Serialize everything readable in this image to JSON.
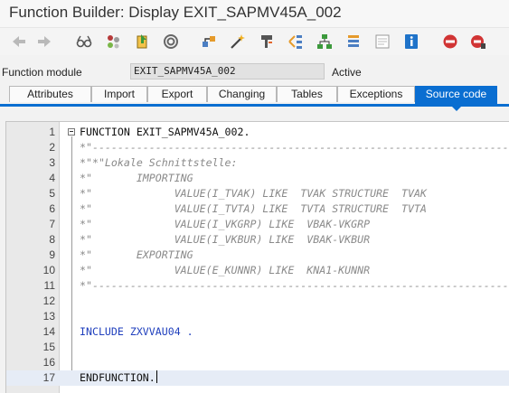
{
  "window": {
    "title": "Function Builder: Display EXIT_SAPMV45A_002"
  },
  "toolbar": {
    "buttons": [
      {
        "icon": "back-arrow-icon"
      },
      {
        "icon": "forward-arrow-icon"
      },
      {
        "icon": "glasses-icon"
      },
      {
        "icon": "other-object-icon"
      },
      {
        "icon": "display-change-icon"
      },
      {
        "icon": "activate-icon"
      },
      {
        "icon": "where-used-icon"
      },
      {
        "icon": "magic-wand-icon"
      },
      {
        "icon": "pretty-printer-icon"
      },
      {
        "icon": "object-list-icon"
      },
      {
        "icon": "hierarchy-icon"
      },
      {
        "icon": "stack-icon"
      },
      {
        "icon": "documentation-icon"
      },
      {
        "icon": "info-icon"
      },
      {
        "icon": "stop-icon"
      },
      {
        "icon": "breakpoint-icon"
      }
    ]
  },
  "header": {
    "label": "Function module",
    "value": "EXIT_SAPMV45A_002",
    "status": "Active"
  },
  "tabs": [
    {
      "label": "Attributes"
    },
    {
      "label": "Import"
    },
    {
      "label": "Export"
    },
    {
      "label": "Changing"
    },
    {
      "label": "Tables"
    },
    {
      "label": "Exceptions"
    },
    {
      "label": "Source code",
      "active": true
    }
  ],
  "editor": {
    "lines": [
      {
        "n": "1",
        "text": "FUNCTION EXIT_SAPMV45A_002.",
        "kind": "code"
      },
      {
        "n": "2",
        "text": "*\"----------------------------------------------------------------------",
        "kind": "comment"
      },
      {
        "n": "3",
        "text": "*\"*\"Lokale Schnittstelle:",
        "kind": "comment"
      },
      {
        "n": "4",
        "text": "*\"       IMPORTING",
        "kind": "comment"
      },
      {
        "n": "5",
        "text": "*\"             VALUE(I_TVAK) LIKE  TVAK STRUCTURE  TVAK",
        "kind": "comment"
      },
      {
        "n": "6",
        "text": "*\"             VALUE(I_TVTA) LIKE  TVTA STRUCTURE  TVTA",
        "kind": "comment"
      },
      {
        "n": "7",
        "text": "*\"             VALUE(I_VKGRP) LIKE  VBAK-VKGRP",
        "kind": "comment"
      },
      {
        "n": "8",
        "text": "*\"             VALUE(I_VKBUR) LIKE  VBAK-VKBUR",
        "kind": "comment"
      },
      {
        "n": "9",
        "text": "*\"       EXPORTING",
        "kind": "comment"
      },
      {
        "n": "10",
        "text": "*\"             VALUE(E_KUNNR) LIKE  KNA1-KUNNR",
        "kind": "comment"
      },
      {
        "n": "11",
        "text": "*\"----------------------------------------------------------------------",
        "kind": "comment"
      },
      {
        "n": "12",
        "text": "",
        "kind": "code"
      },
      {
        "n": "13",
        "text": "",
        "kind": "code"
      },
      {
        "n": "14",
        "text": "INCLUDE ZXVVAU04 .",
        "kind": "include"
      },
      {
        "n": "15",
        "text": "",
        "kind": "code"
      },
      {
        "n": "16",
        "text": "",
        "kind": "code"
      },
      {
        "n": "17",
        "text": "ENDFUNCTION.",
        "kind": "code"
      }
    ]
  }
}
